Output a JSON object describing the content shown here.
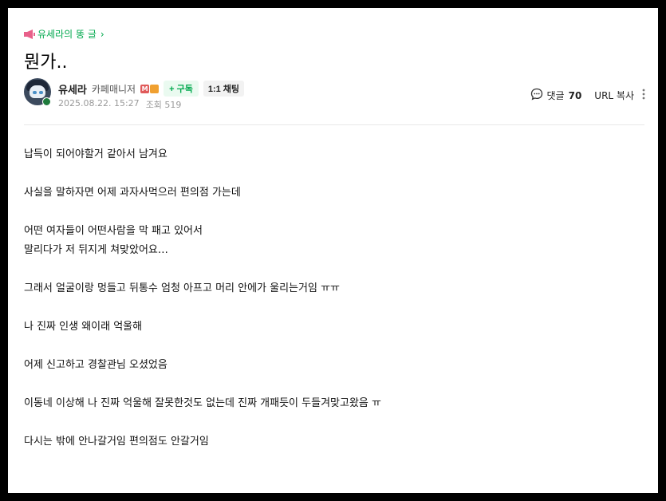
{
  "board": {
    "label": "유세라의 똥 글"
  },
  "post": {
    "title": "뭔가.."
  },
  "author": {
    "name": "유세라",
    "role": "카페매니저",
    "subscribe_label": "+ 구독",
    "chat_label": "1:1 채팅",
    "date": "2025.08.22. 15:27",
    "views": "조회 519"
  },
  "tools": {
    "comment_label": "댓글",
    "comment_count": "70",
    "url_copy_label": "URL 복사"
  },
  "content": {
    "paragraphs": [
      [
        "납득이 되어야할거 같아서 남겨요"
      ],
      [
        "사실을 말하자면 어제 과자사먹으러 편의점 가는데"
      ],
      [
        "어떤 여자들이 어떤사람을 막 패고 있어서",
        "말리다가 저 뒤지게 쳐맞았어요…"
      ],
      [
        "그래서 얼굴이랑 멍들고 뒤통수 엄청 아프고 머리 안에가 울리는거임 ㅠㅠ"
      ],
      [
        "나 진짜 인생 왜이래 억울해"
      ],
      [
        "어제 신고하고 경찰관님 오셨었음"
      ],
      [
        "이동네 이상해 나 진짜 억울해 잘못한것도 없는데 진짜 개패듯이 두들겨맞고왔음 ㅠ"
      ],
      [
        "다시는 밖에 안나갈거임 편의점도 안갈거임"
      ]
    ]
  },
  "colors": {
    "accent": "#03a94f",
    "frame": "#000000"
  },
  "icons": [
    "megaphone-icon",
    "chevron-right-icon",
    "comment-icon",
    "more-vertical-icon",
    "manager-badge-icon"
  ]
}
